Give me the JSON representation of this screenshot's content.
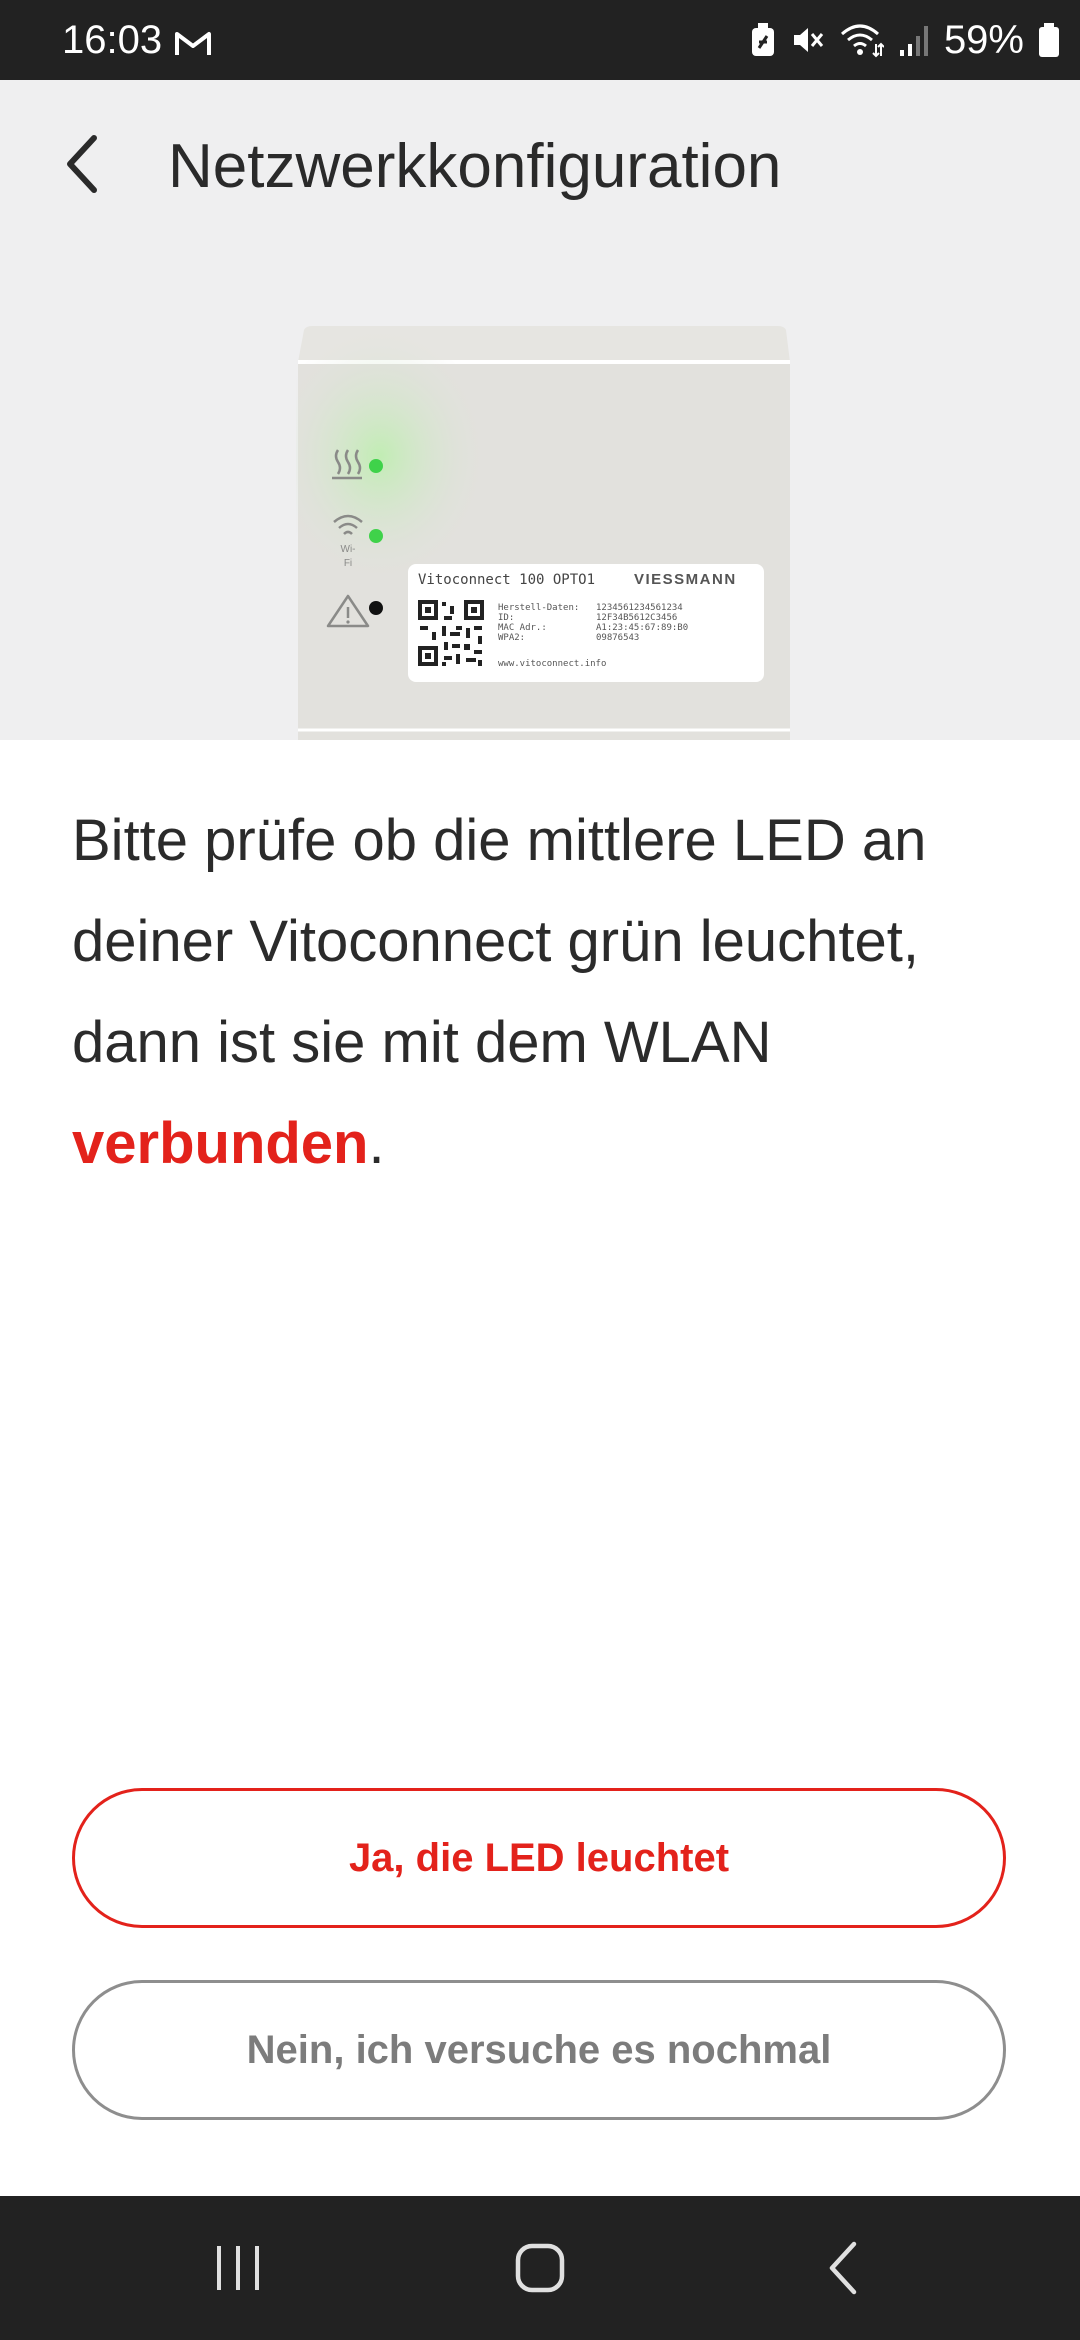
{
  "status_bar": {
    "time": "16:03",
    "battery": "59%",
    "icons": [
      "gmail-icon",
      "battery-saver-icon",
      "mute-icon",
      "wifi-icon",
      "signal-icon",
      "battery-icon"
    ]
  },
  "header": {
    "title": "Netzwerkkonfiguration",
    "back_icon": "chevron-left-icon"
  },
  "device": {
    "model": "Vitoconnect",
    "model_number": "100",
    "variant": "OPTO1",
    "brand": "VIESSMANN",
    "label_rows": [
      {
        "key": "Herstell-Daten:",
        "value": "1234561234561234"
      },
      {
        "key": "ID:",
        "value": "12F34B5612C3456"
      },
      {
        "key": "MAC Adr.:",
        "value": "A1:23:45:67:89:B0"
      },
      {
        "key": "WPA2:",
        "value": "09876543"
      }
    ],
    "website": "www.vitoconnect.info",
    "led_wifi_caption": "Wi-Fi",
    "leds": [
      {
        "name": "heating",
        "color": "#3fd24a"
      },
      {
        "name": "wifi",
        "color": "#3fd24a"
      },
      {
        "name": "warning",
        "color": "#111111"
      }
    ]
  },
  "content": {
    "instruction_prefix": "Bitte prüfe ob die mittlere LED an deiner Vitoconnect grün leuchtet, dann ist sie mit dem WLAN ",
    "instruction_highlight": "verbunden",
    "instruction_suffix": ".",
    "accent_color": "#e3221b"
  },
  "actions": {
    "confirm_label": "Ja, die LED leuchtet",
    "retry_label": "Nein, ich versuche es nochmal"
  },
  "nav_bar": {
    "items": [
      "recent-apps-icon",
      "home-icon",
      "back-icon"
    ]
  }
}
